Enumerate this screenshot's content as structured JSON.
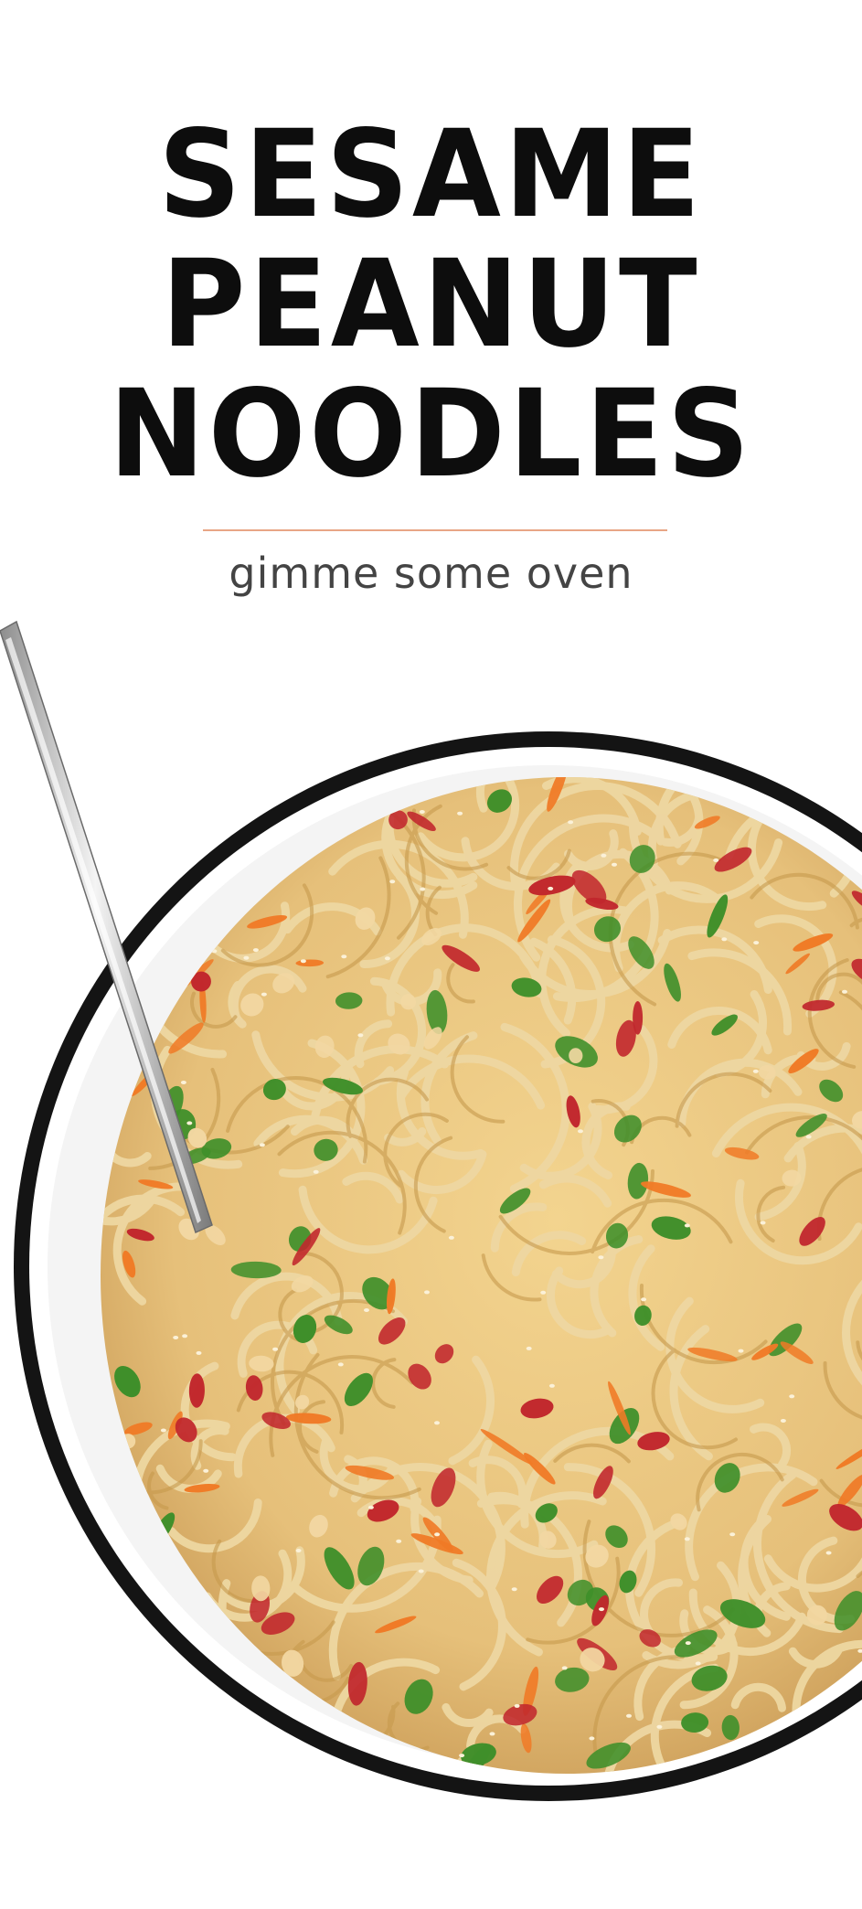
{
  "title": {
    "line1": "SESAME",
    "line2": "PEANUT",
    "line3": "NOODLES"
  },
  "brand": "gimme some oven",
  "colors": {
    "background": "#ffffff",
    "title": "#0d0d0d",
    "divider": "#e8a585",
    "brand": "#444444",
    "bowl_rim": "#111111",
    "noodle": "#e7c98a",
    "carrot": "#f07a26",
    "cabbage": "#c1272d",
    "herb": "#3f8f2a",
    "peanut": "#f2d7a2"
  },
  "image": {
    "subject": "bowl-of-sesame-peanut-noodles",
    "utensil": "fork"
  }
}
